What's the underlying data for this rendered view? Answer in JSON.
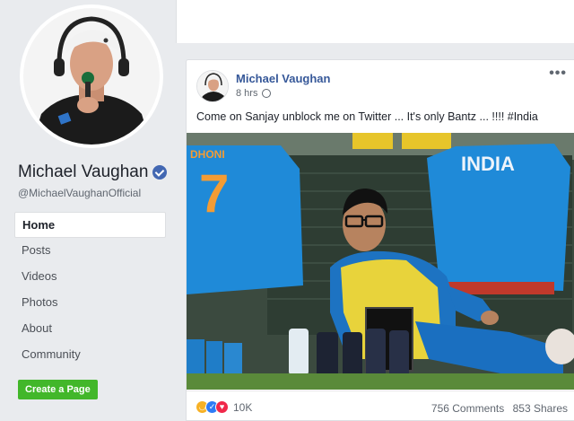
{
  "profile": {
    "name": "Michael Vaughan",
    "handle": "@MichaelVaughanOfficial"
  },
  "nav": {
    "items": [
      {
        "label": "Home",
        "active": true
      },
      {
        "label": "Posts"
      },
      {
        "label": "Videos"
      },
      {
        "label": "Photos"
      },
      {
        "label": "About"
      },
      {
        "label": "Community"
      }
    ],
    "create_page_label": "Create a Page"
  },
  "post": {
    "author": "Michael Vaughan",
    "time": "8 hrs",
    "privacy_icon": "globe-icon",
    "more_icon": "more-options-icon",
    "text": "Come on Sanjay unblock me on Twitter ... It's only Bantz ... !!!! #India",
    "image": {
      "jersey_number": "7",
      "jersey_name_left": "DHONI",
      "jersey_text_right": "INDIA"
    },
    "reactions": {
      "types": [
        "haha",
        "like",
        "love"
      ],
      "count": "10K"
    },
    "comments": "756 Comments",
    "shares": "853 Shares"
  },
  "colors": {
    "facebook_blue": "#4267b2",
    "link_blue": "#365899",
    "create_green": "#42b72a",
    "background": "#e9ebee",
    "jersey_blue": "#1f8ad8"
  }
}
